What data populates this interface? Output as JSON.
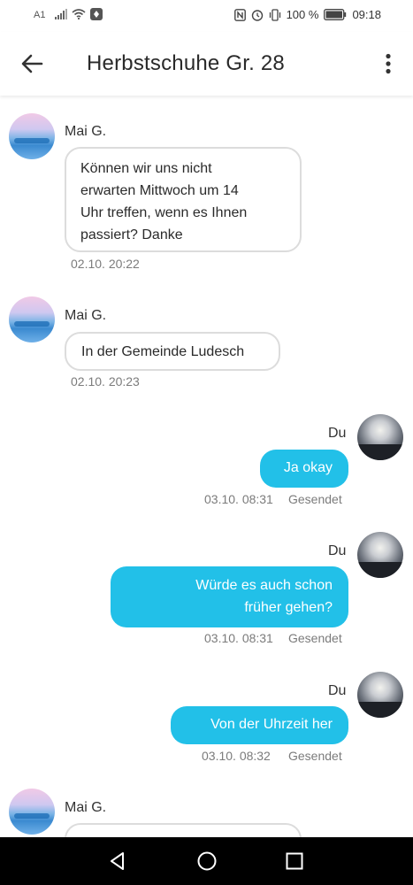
{
  "status_bar": {
    "carrier": "A1",
    "battery": "100 %",
    "time": "09:18",
    "icons": [
      "signal-icon",
      "wifi-icon",
      "notification-icon",
      "nfc-icon",
      "alarm-icon",
      "vibrate-icon",
      "battery-icon"
    ]
  },
  "header": {
    "title": "Herbstschuhe Gr. 28",
    "back_icon": "arrow-left-icon",
    "menu_icon": "more-vertical-icon"
  },
  "messages": [
    {
      "direction": "in",
      "sender": "Mai G.",
      "lines": [
        "Können wir uns nicht",
        "erwarten Mittwoch um 14",
        "Uhr treffen, wenn es Ihnen",
        "passiert?  Danke"
      ],
      "time": "02.10. 20:22"
    },
    {
      "direction": "in",
      "sender": "Mai G.",
      "lines": [
        "In der Gemeinde Ludesch"
      ],
      "time": "02.10. 20:23"
    },
    {
      "direction": "out",
      "sender": "Du",
      "lines": [
        "Ja okay"
      ],
      "time": "03.10. 08:31",
      "status": "Gesendet"
    },
    {
      "direction": "out",
      "sender": "Du",
      "lines": [
        "Würde es auch schon",
        "früher gehen?"
      ],
      "time": "03.10. 08:31",
      "status": "Gesendet"
    },
    {
      "direction": "out",
      "sender": "Du",
      "lines": [
        "Von der Uhrzeit her"
      ],
      "time": "03.10. 08:32",
      "status": "Gesendet"
    },
    {
      "direction": "in",
      "sender": "Mai G.",
      "lines": []
    }
  ],
  "colors": {
    "outgoing_bubble": "#22c0e8",
    "incoming_border": "#dcdcdc",
    "meta_text": "#7b7b7b"
  },
  "nav": {
    "icons": [
      "back-triangle-icon",
      "home-circle-icon",
      "recents-square-icon"
    ]
  }
}
